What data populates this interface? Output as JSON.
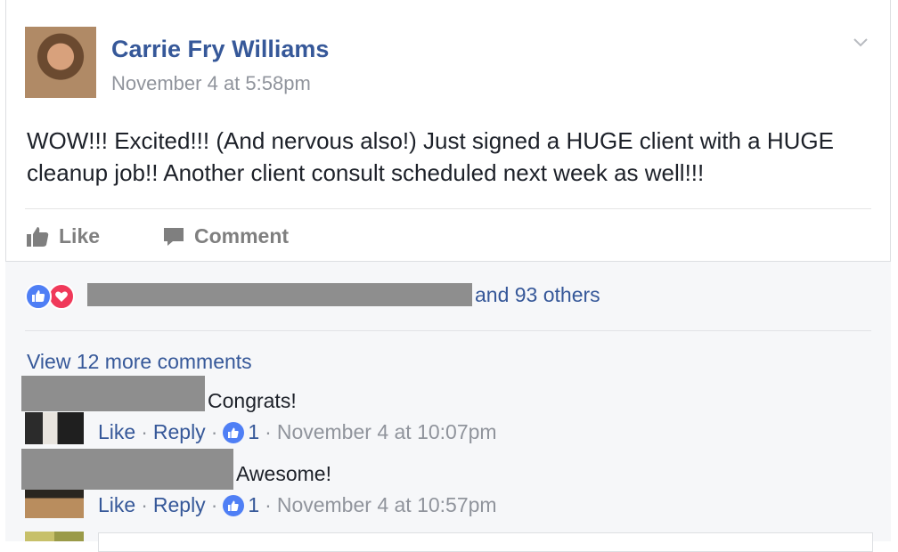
{
  "post": {
    "author": "Carrie Fry Williams",
    "timestamp": "November 4 at 5:58pm",
    "text": "WOW!!! Excited!!! (And nervous also!) Just signed a HUGE client with a HUGE cleanup job!! Another client consult scheduled next week as well!!!"
  },
  "actions": {
    "like": "Like",
    "comment": "Comment"
  },
  "reactions": {
    "summary_suffix": "and 93 others",
    "types": [
      "like",
      "love"
    ]
  },
  "comments_section": {
    "view_more": "View 12 more comments",
    "comments": [
      {
        "text": "Congrats!",
        "like_label": "Like",
        "reply_label": "Reply",
        "reaction_count": "1",
        "time": "November 4 at 10:07pm"
      },
      {
        "text": "Awesome!",
        "like_label": "Like",
        "reply_label": "Reply",
        "reaction_count": "1",
        "time": "November 4 at 10:57pm"
      }
    ]
  },
  "colors": {
    "link": "#365899",
    "muted": "#90949c",
    "like_blue": "#4f7ff5",
    "love_red": "#f0395a",
    "redaction": "#8e8e8e"
  }
}
